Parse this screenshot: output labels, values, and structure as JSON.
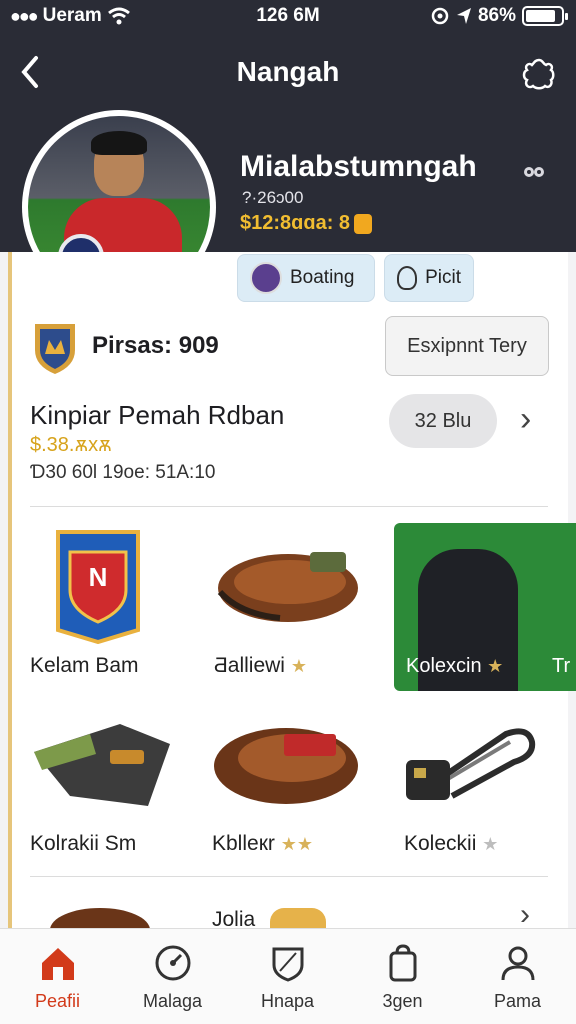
{
  "status_bar": {
    "carrier": "Ueram",
    "time": "126 6M",
    "battery": "86%",
    "battery_level": 0.86
  },
  "nav": {
    "title": "Nangah"
  },
  "profile": {
    "name": "Mialabstumngah",
    "id": "?·26ɔ00",
    "balance": "$12:8ɑɑa: 8"
  },
  "chips": {
    "boost_label": "Boating",
    "pick_label": "Picit"
  },
  "points": {
    "label": "Pirsas: 909"
  },
  "explore_button": {
    "label": "Esxipnnt Tery"
  },
  "summary": {
    "title": "Kinpiar Pemah Rdban",
    "value": "$.38.ѫxѫ",
    "meta": "Ɗ30 60l 19oe: 51A:10",
    "pill_label": "32 Blu"
  },
  "items": [
    {
      "label": "Kelam Bam",
      "icon": "team-badge-icon"
    },
    {
      "label": "Ƌalliewi",
      "icon": "glove-icon",
      "stars": "★"
    },
    {
      "label": "Kolexcin",
      "icon": "jacket-icon",
      "stars": "★",
      "next_label": "Tr"
    },
    {
      "label": "Kolrakii Sm",
      "icon": "gloves-icon"
    },
    {
      "label": "Kblleкr",
      "icon": "wallet-icon",
      "stars": "★★"
    },
    {
      "label": "Koleckii",
      "icon": "lock-icon",
      "stars": "★"
    },
    {
      "label": "Jolia",
      "icon": "badge-icon"
    }
  ],
  "tabs": [
    {
      "label": "Peafii",
      "icon": "home-icon",
      "active": true
    },
    {
      "label": "Malaga",
      "icon": "gauge-icon"
    },
    {
      "label": "Hnapa",
      "icon": "shield-icon"
    },
    {
      "label": "3gen",
      "icon": "bag-icon"
    },
    {
      "label": "Pama",
      "icon": "profile-icon"
    }
  ],
  "colors": {
    "header": "#2a2c36",
    "accent": "#d23a1a",
    "gold": "#f1bd31",
    "featured_bg": "#2c8a38"
  }
}
